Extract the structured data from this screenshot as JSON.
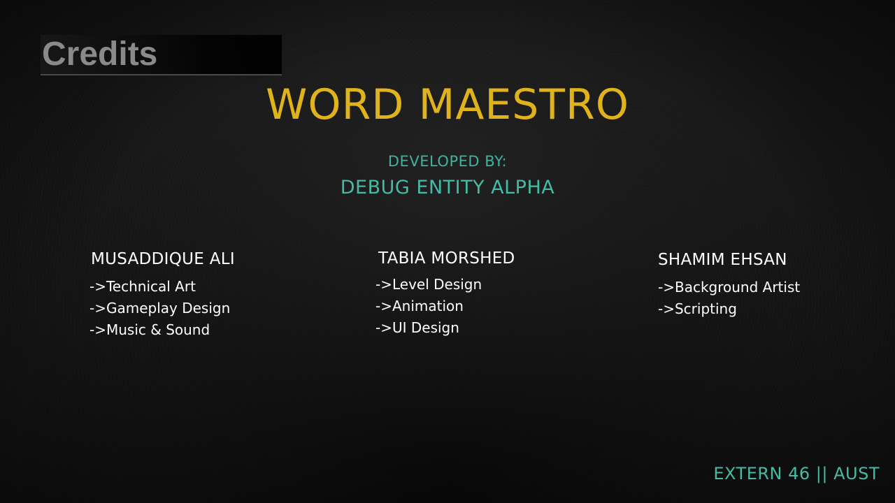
{
  "screen": {
    "header": "Credits",
    "game_title": "WORD MAESTRO",
    "developed_by_label": "DEVELOPED BY:",
    "developer_name": "DEBUG ENTITY ALPHA",
    "footer": "EXTERN 46 || AUST"
  },
  "team": [
    {
      "name": "MUSADDIQUE ALI",
      "roles": [
        "->Technical Art",
        "->Gameplay Design",
        "->Music & Sound"
      ]
    },
    {
      "name": "TABIA MORSHED",
      "roles": [
        "->Level Design",
        "->Animation",
        "->UI Design"
      ]
    },
    {
      "name": "SHAMIM EHSAN",
      "roles": [
        "->Background Artist",
        "->Scripting"
      ]
    }
  ],
  "colors": {
    "title": "#e0b21c",
    "accent": "#45bba6",
    "header_text": "#8a8a8a",
    "body_text": "#ffffff",
    "background": "#141414"
  }
}
